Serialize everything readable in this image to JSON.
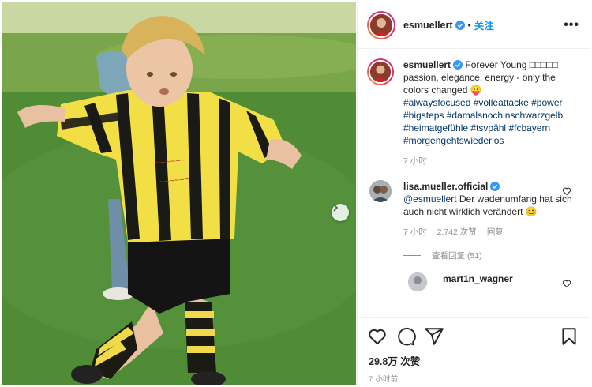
{
  "post": {
    "author": "esmuellert",
    "follow_label": "关注",
    "separator": "•",
    "more_label": "•••"
  },
  "caption": {
    "author": "esmuellert",
    "text_line1": " Forever Young □□□□□",
    "text_line2": "passion, elegance, energy - only the colors changed 😛",
    "hashtags": [
      "#alwaysfocused",
      "#volleattacke",
      "#power",
      "#bigsteps",
      "#damalsnochinschwarzgelb",
      "#heimatgefühle",
      "#tsvpähl",
      "#fcbayern",
      "#morgengehtswiederlos"
    ],
    "time": "7 小时"
  },
  "comments": [
    {
      "author": "lisa.mueller.official",
      "mention": "@esmuellert",
      "text": " Der wadenumfang hat sich auch nicht wirklich verändert 😊",
      "time": "7 小时",
      "likes": "2,742 次赞",
      "reply": "回复",
      "view_replies": "查看回复 (51)"
    },
    {
      "author": "mart1n_wagner"
    }
  ],
  "footer": {
    "likes": "29.8万 次赞",
    "time_ago": "7 小时前"
  },
  "icons": [
    "verified-badge-icon",
    "heart-icon",
    "comment-icon",
    "share-icon",
    "bookmark-icon",
    "chevron-right-icon",
    "more-icon"
  ],
  "colors": {
    "link": "#0095f6",
    "hashtag": "#00376b",
    "muted": "#8e8e8e",
    "verified": "#3897f0"
  }
}
